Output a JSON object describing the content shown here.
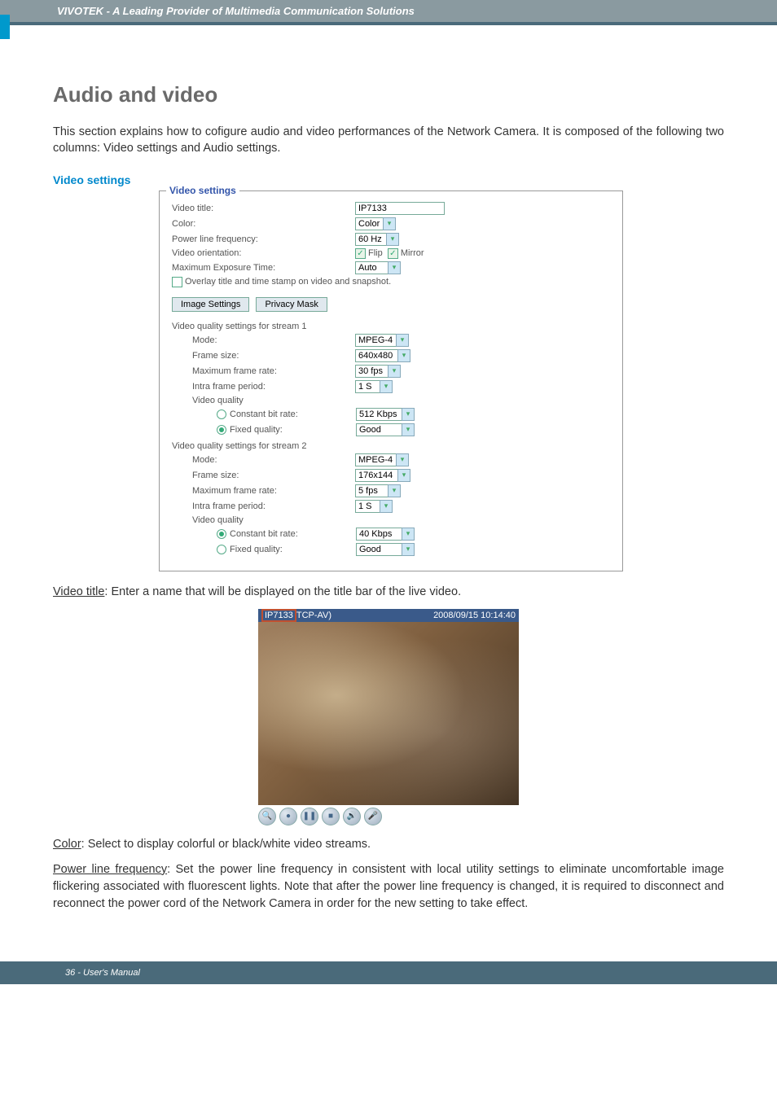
{
  "header": {
    "brand_line": "VIVOTEK - A Leading Provider of Multimedia Communication Solutions"
  },
  "page": {
    "h1": "Audio and video",
    "intro": "This section explains how to cofigure audio and video performances of the Network Camera. It is composed of the following two columns: Video settings and Audio settings.",
    "video_settings_label": "Video settings"
  },
  "video_settings": {
    "panel_title": "Video settings",
    "fields": {
      "video_title_label": "Video title:",
      "video_title_value": "IP7133",
      "color_label": "Color:",
      "color_value": "Color",
      "plf_label": "Power line frequency:",
      "plf_value": "60 Hz",
      "orientation_label": "Video orientation:",
      "flip_label": "Flip",
      "mirror_label": "Mirror",
      "met_label": "Maximum Exposure Time:",
      "met_value": "Auto",
      "overlay_label": "Overlay title and time stamp on video and snapshot."
    },
    "buttons": {
      "image_settings": "Image Settings",
      "privacy_mask": "Privacy Mask"
    },
    "stream1": {
      "header": "Video quality settings for stream 1",
      "mode_label": "Mode:",
      "mode_value": "MPEG-4",
      "frame_size_label": "Frame size:",
      "frame_size_value": "640x480",
      "max_fr_label": "Maximum frame rate:",
      "max_fr_value": "30 fps",
      "intra_label": "Intra frame period:",
      "intra_value": "1 S",
      "vq_label": "Video quality",
      "cbr_label": "Constant bit rate:",
      "cbr_value": "512 Kbps",
      "fq_label": "Fixed quality:",
      "fq_value": "Good"
    },
    "stream2": {
      "header": "Video quality settings for stream 2",
      "mode_label": "Mode:",
      "mode_value": "MPEG-4",
      "frame_size_label": "Frame size:",
      "frame_size_value": "176x144",
      "max_fr_label": "Maximum frame rate:",
      "max_fr_value": "5 fps",
      "intra_label": "Intra frame period:",
      "intra_value": "1 S",
      "vq_label": "Video quality",
      "cbr_label": "Constant bit rate:",
      "cbr_value": "40 Kbps",
      "fq_label": "Fixed quality:",
      "fq_value": "Good"
    }
  },
  "preview": {
    "title_overlay": "IP7133",
    "protocol": "TCP-AV)",
    "timestamp": "2008/09/15 10:14:40"
  },
  "descriptions": {
    "video_title_key": "Video title",
    "video_title_text": ": Enter a name that will be displayed on the title bar of the live video.",
    "color_key": "Color",
    "color_text": ": Select to display colorful or black/white video streams.",
    "plf_key": "Power line frequency",
    "plf_text": ": Set the power line frequency in consistent with local utility settings to eliminate uncomfortable image flickering associated with fluorescent lights. Note that after the power line frequency is changed, it is required to disconnect and reconnect the power cord of the Network Camera in order for the new setting to take effect."
  },
  "footer": {
    "page_label": "36 - User's Manual"
  }
}
